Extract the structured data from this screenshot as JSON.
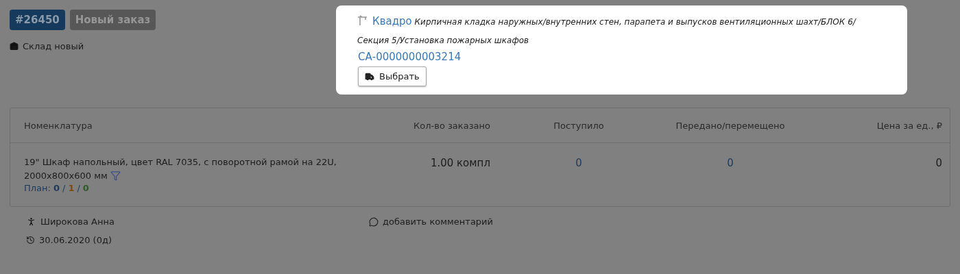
{
  "order": {
    "number": "#26450",
    "status": "Новый заказ"
  },
  "warehouse": "Склад новый",
  "highlight": {
    "contractor": "Квадро",
    "description": "Кирпичная кладка наружных/внутренних стен, парапета и выпусков вентиляционных шахт/БЛОК 6/Секция 5/Установка пожарных шкафов",
    "code": "СА-0000000003214",
    "button": "Выбрать"
  },
  "table": {
    "columns": [
      "Номенклатура",
      "Кол-во заказано",
      "Поступило",
      "Передано/перемещено",
      "Цена за ед., ₽"
    ],
    "rows": [
      {
        "name": "19\" Шкаф напольный, цвет RAL 7035, с поворотной рамой на 22U, 2000x800x600 мм",
        "plan_label": "План:",
        "plan_separator": "/",
        "plan": [
          {
            "value": "0",
            "color": "#1f3a58"
          },
          {
            "value": "1",
            "color": "#7a4a12"
          },
          {
            "value": "0",
            "color": "#2f5a2a"
          }
        ],
        "ordered": "1.00 компл",
        "received": "0",
        "transferred": "0",
        "price": "0"
      }
    ]
  },
  "author": "Широкова Анна",
  "date": "30.06.2020 (0д)",
  "comment_link": "добавить комментарий"
}
